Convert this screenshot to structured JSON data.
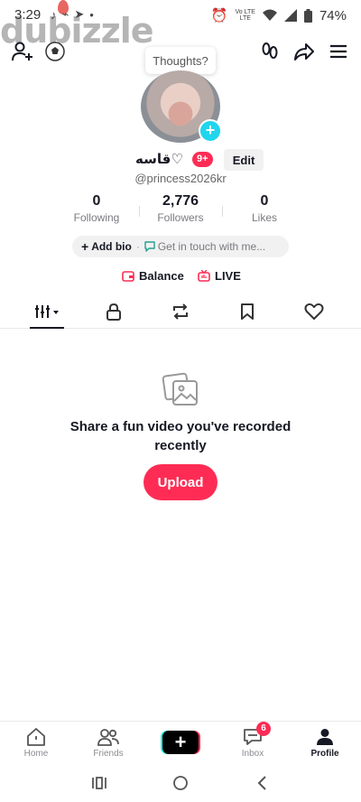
{
  "status_bar": {
    "time": "3:29",
    "battery": "74%",
    "network_top": "Vo LTE",
    "network_bottom": "LTE"
  },
  "watermark": "dubizzle",
  "tooltip": "Thoughts?",
  "profile": {
    "display_name": "قاسه♡",
    "badge": "9+",
    "edit_label": "Edit",
    "username": "@princess2026kr"
  },
  "stats": [
    {
      "value": "0",
      "label": "Following"
    },
    {
      "value": "2,776",
      "label": "Followers"
    },
    {
      "value": "0",
      "label": "Likes"
    }
  ],
  "bio": {
    "add_bio": "Add bio",
    "get_in_touch": "Get in touch with me..."
  },
  "links": {
    "balance": "Balance",
    "live": "LIVE"
  },
  "empty_state": {
    "title": "Share a fun video you've recorded recently",
    "upload": "Upload"
  },
  "bottom_nav": {
    "home": "Home",
    "friends": "Friends",
    "inbox": "Inbox",
    "inbox_count": "6",
    "profile": "Profile"
  },
  "colors": {
    "accent": "#fe2c55",
    "cyan": "#20d5ec"
  }
}
